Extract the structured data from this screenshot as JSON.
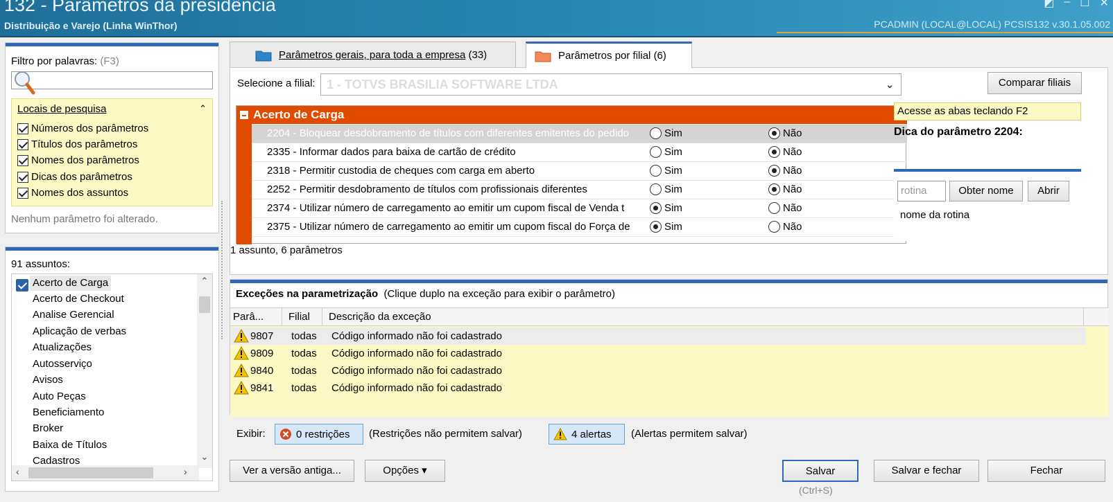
{
  "window": {
    "title": "132 - Parâmetros da presidência",
    "subtitle": "Distribuição e Varejo (Linha WinThor)",
    "userinfo": "PCADMIN (LOCAL@LOCAL)  PCSIS132  v.30.1.05.002"
  },
  "filter": {
    "label": "Filtro por palavras:",
    "shortcut": "(F3)",
    "locais_header": "Locais de pesquisa",
    "options": [
      "Números dos parâmetros",
      "Títulos dos parâmetros",
      "Nomes dos parâmetros",
      "Dicas dos parâmetros",
      "Nomes dos assuntos"
    ],
    "status": "Nenhum parâmetro foi alterado."
  },
  "subjects": {
    "label": "91 assuntos:",
    "items": [
      "Acerto de Carga",
      "Acerto de Checkout",
      "Analise Gerencial",
      "Aplicação de verbas",
      "Atualizações",
      "Autosserviço",
      "Avisos",
      "Auto Peças",
      "Beneficiamento",
      "Broker",
      "Baixa de Títulos",
      "Cadastros"
    ]
  },
  "tabs": {
    "general": "Parâmetros gerais, para toda a empresa",
    "general_count": "(33)",
    "branch": "Parâmetros por filial",
    "branch_count": "(6)"
  },
  "main": {
    "select_label": "Selecione a filial:",
    "filial_value": "1 - TOTVS BRASILIA SOFTWARE LTDA",
    "compare_button": "Comparar filiais",
    "category": "Acerto de Carga",
    "params": [
      {
        "text": "2204 - Bloquear desdobramento de títulos com diferentes emitentes do pedido",
        "value": "nao"
      },
      {
        "text": "2335 - Informar dados para baixa de cartão de crédito",
        "value": "nao"
      },
      {
        "text": "2318 - Permitir custodia de cheques com carga em aberto",
        "value": "nao"
      },
      {
        "text": "2252 - Permitir desdobramento de títulos com profissionais diferentes",
        "value": "nao"
      },
      {
        "text": "2374 - Utilizar número de carregamento ao emitir um cupom fiscal de Venda t",
        "value": "sim"
      },
      {
        "text": "2375 - Utilizar número de carregamento ao emitir um cupom fiscal do Força de",
        "value": "sim"
      }
    ],
    "sim": "Sim",
    "nao": "Não",
    "count_text": "1 assunto, 6 parâmetros"
  },
  "tips": {
    "access": "Acesse as abas teclando F2",
    "title": "Dica do parâmetro 2204:",
    "rotina_placeholder": "rotina",
    "obter": "Obter nome",
    "abrir": "Abrir",
    "nome": "nome da rotina"
  },
  "exceptions": {
    "title": "Exceções na parametrização",
    "subtitle": "(Clique duplo na exceção para exibir o parâmetro)",
    "col_param": "Parâ...",
    "col_filial": "Filial",
    "col_desc": "Descrição da exceção",
    "rows": [
      {
        "param": "9807",
        "filial": "todas",
        "desc": "Código informado não foi cadastrado"
      },
      {
        "param": "9809",
        "filial": "todas",
        "desc": "Código informado não foi cadastrado"
      },
      {
        "param": "9840",
        "filial": "todas",
        "desc": "Código informado não foi cadastrado"
      },
      {
        "param": "9841",
        "filial": "todas",
        "desc": "Código informado não foi cadastrado"
      }
    ]
  },
  "exibir": {
    "label": "Exibir:",
    "restricoes": "0 restrições",
    "restricoes_note": "(Restrições não permitem salvar)",
    "alertas": "4 alertas",
    "alertas_note": "(Alertas permitem salvar)"
  },
  "buttons": {
    "old_version": "Ver a versão antiga...",
    "options": "Opções ▾",
    "save": "Salvar",
    "save_shortcut": "(Ctrl+S)",
    "save_close": "Salvar e fechar",
    "close": "Fechar"
  },
  "colors": {
    "accent_blue": "#2f68b4",
    "category_orange": "#e04b00",
    "highlight_yellow": "#fdf9c4"
  }
}
